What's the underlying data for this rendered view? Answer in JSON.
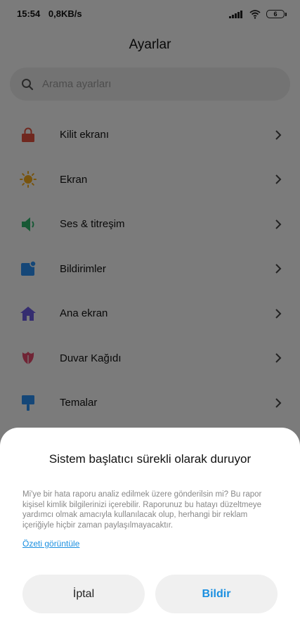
{
  "status_bar": {
    "time": "15:54",
    "speed": "0,8KB/s",
    "battery": "6"
  },
  "page_title": "Ayarlar",
  "search": {
    "placeholder": "Arama ayarları"
  },
  "settings": [
    {
      "label": "Kilit ekranı",
      "icon": "lock-icon",
      "color": "#e0513f"
    },
    {
      "label": "Ekran",
      "icon": "sun-icon",
      "color": "#f0a81c"
    },
    {
      "label": "Ses & titreşim",
      "icon": "speaker-icon",
      "color": "#2fb36a"
    },
    {
      "label": "Bildirimler",
      "icon": "notification-icon",
      "color": "#2a8ff0"
    },
    {
      "label": "Ana ekran",
      "icon": "home-icon",
      "color": "#6a5ae0"
    },
    {
      "label": "Duvar Kağıdı",
      "icon": "tulip-icon",
      "color": "#e0486a"
    },
    {
      "label": "Temalar",
      "icon": "brush-icon",
      "color": "#2a8ff0"
    }
  ],
  "dialog": {
    "title": "Sistem başlatıcı sürekli olarak duruyor",
    "message": "Mi'ye bir hata raporu analiz edilmek üzere gönderilsin mi? Bu rapor kişisel kimlik bilgilerinizi içerebilir. Raporunuz bu hatayı düzeltmeye yardımcı olmak amacıyla kullanılacak olup, herhangi bir reklam içeriğiyle hiçbir zaman paylaşılmayacaktır.",
    "link": "Özeti görüntüle",
    "cancel": "İptal",
    "report": "Bildir"
  }
}
